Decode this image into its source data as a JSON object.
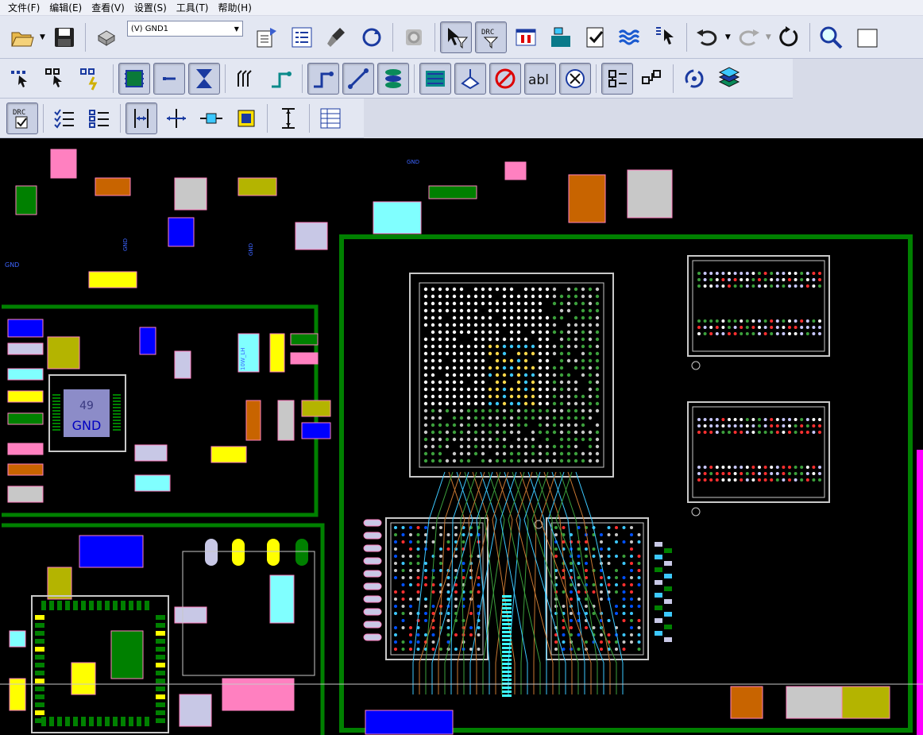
{
  "menu": {
    "items": [
      {
        "label": "文件(F)"
      },
      {
        "label": "编辑(E)"
      },
      {
        "label": "查看(V)"
      },
      {
        "label": "设置(S)"
      },
      {
        "label": "工具(T)"
      },
      {
        "label": "帮助(H)"
      }
    ]
  },
  "toolbar": {
    "net_select_value": "(V) GND1",
    "drc_label": "DRC",
    "text_tool_label": "abl"
  },
  "board": {
    "ic_label_number": "49",
    "ic_label_net": "GND",
    "pad_labels": [
      "GND",
      "GND",
      "GND",
      "GND"
    ],
    "part_label": "10W_LH"
  },
  "colors": {
    "board_bg": "#000000",
    "outline_green": "#008000",
    "pad_blue": "#0000ff",
    "pad_lavender": "#c8c8e6",
    "pad_cyan": "#80ffff",
    "pad_yellow": "#ffff00",
    "trace_orange": "#c87832",
    "trace_cyan": "#3cc8ff",
    "silkscreen": "#c8c8c8",
    "keepout_pink": "#ff80c0",
    "magenta_edge": "#ff00ff"
  }
}
